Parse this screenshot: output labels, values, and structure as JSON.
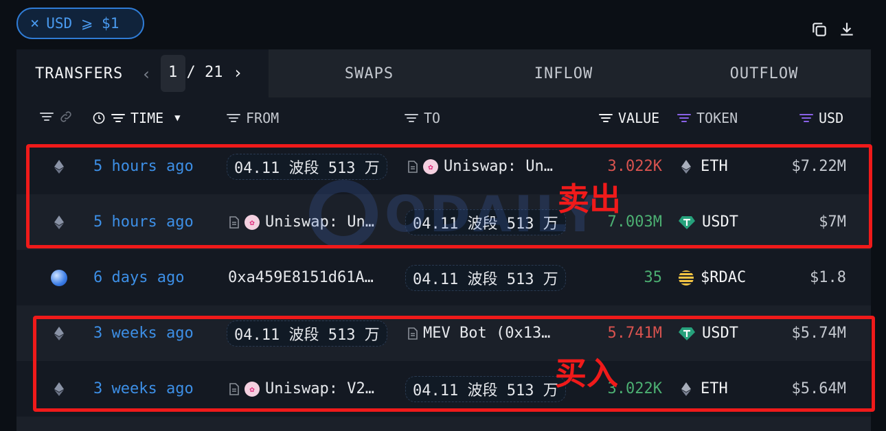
{
  "filter": {
    "close": "×",
    "label": "USD ⩾ $1"
  },
  "tabs": {
    "transfers": "TRANSFERS",
    "pager": {
      "prev": "‹",
      "current": "1",
      "separator": " / ",
      "total": "21",
      "next": "›"
    },
    "swaps": "SWAPS",
    "inflow": "INFLOW",
    "outflow": "OUTFLOW"
  },
  "headers": {
    "time": "TIME",
    "from": "FROM",
    "to": "TO",
    "value": "VALUE",
    "token": "TOKEN",
    "usd": "USD"
  },
  "rows": [
    {
      "time": "5 hours ago",
      "from": "04.11 波段 513 万",
      "to": "Uniswap: Un…",
      "value": "3.022K",
      "token": "ETH",
      "usd": "$7.22M"
    },
    {
      "time": "5 hours ago",
      "from": "Uniswap: Un…",
      "to": "04.11 波段 513 万",
      "value": "7.003M",
      "token": "USDT",
      "usd": "$7M"
    },
    {
      "time": "6 days ago",
      "from": "0xa459E8151d61A…",
      "to": "04.11 波段 513 万",
      "value": "35",
      "token": "$RDAC",
      "usd": "$1.8"
    },
    {
      "time": "3 weeks ago",
      "from": "04.11 波段 513 万",
      "to": "MEV Bot (0x13…",
      "value": "5.741M",
      "token": "USDT",
      "usd": "$5.74M"
    },
    {
      "time": "3 weeks ago",
      "from": "Uniswap: V2…",
      "to": "04.11 波段 513 万",
      "value": "3.022K",
      "token": "ETH",
      "usd": "$5.64M"
    }
  ],
  "annotations": {
    "sell": "卖出",
    "buy": "买入"
  },
  "watermark": "ODAILY",
  "colors": {
    "accent": "#3d8fe6",
    "negative": "#d9534f",
    "positive": "#4caf72",
    "annotation": "#f01a1a"
  }
}
